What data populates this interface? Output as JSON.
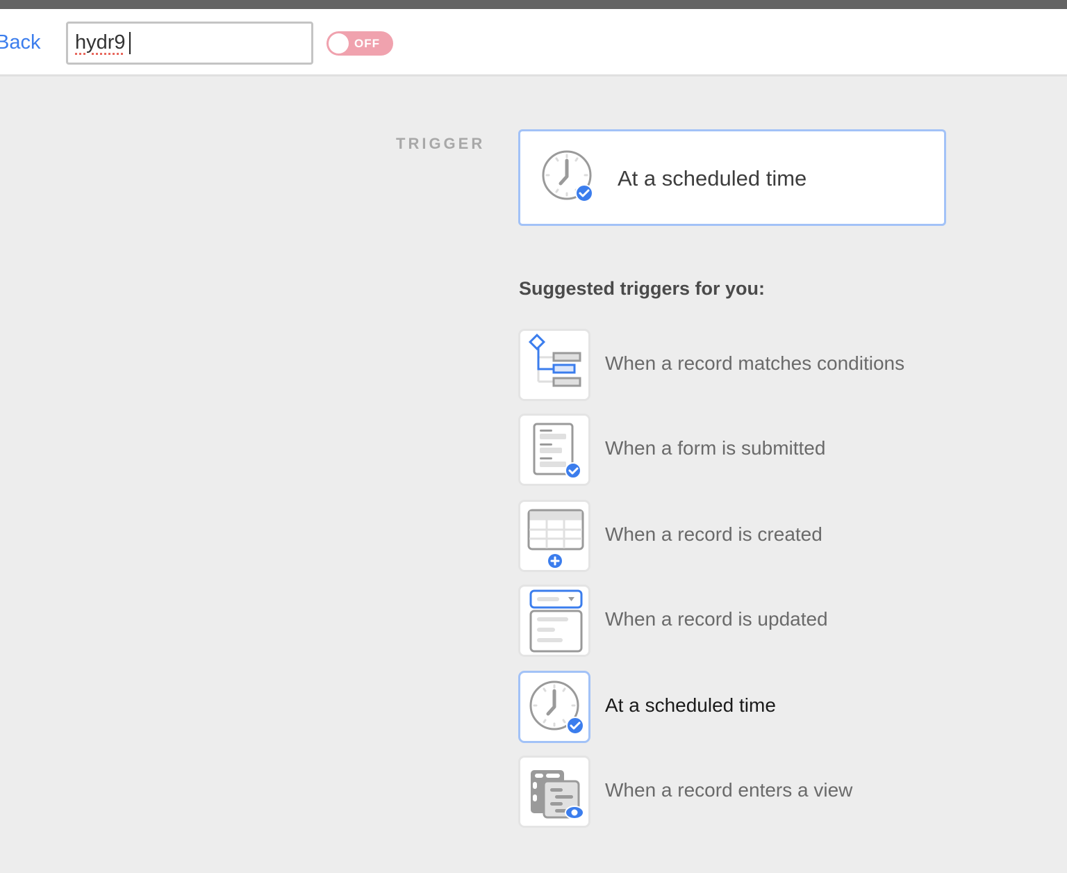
{
  "header": {
    "back_label": "Back",
    "name_value": "hydr9",
    "toggle_state": "OFF",
    "toggle_color": "#f0a2ae"
  },
  "trigger": {
    "section_label": "TRIGGER",
    "selected_label": "At a scheduled time",
    "selected_icon": "clock-check-icon"
  },
  "suggestions": {
    "title": "Suggested triggers for you:",
    "items": [
      {
        "label": "When a record matches conditions",
        "icon": "conditions-branch-icon",
        "selected": false
      },
      {
        "label": "When a form is submitted",
        "icon": "form-check-icon",
        "selected": false
      },
      {
        "label": "When a record is created",
        "icon": "table-plus-icon",
        "selected": false
      },
      {
        "label": "When a record is updated",
        "icon": "record-update-icon",
        "selected": false
      },
      {
        "label": "At a scheduled time",
        "icon": "clock-check-icon",
        "selected": true
      },
      {
        "label": "When a record enters a view",
        "icon": "view-eye-icon",
        "selected": false
      }
    ]
  },
  "colors": {
    "accent": "#3b7ded",
    "selected_border": "#a2c2f7",
    "icon_gray": "#9a9a9a"
  }
}
